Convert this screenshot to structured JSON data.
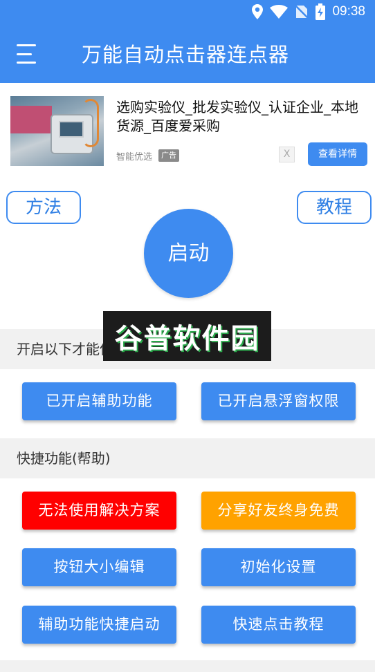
{
  "status_bar": {
    "time": "09:38",
    "icons": [
      "location-icon",
      "wifi-icon",
      "no-sim-icon",
      "battery-charging-icon"
    ]
  },
  "app_bar": {
    "menu_icon": "hamburger-menu-icon",
    "title": "万能自动点击器连点器"
  },
  "ad": {
    "title": "选购实验仪_批发实验仪_认证企业_本地货源_百度爱采购",
    "source": "智能优选",
    "tag": "广告",
    "close": "X",
    "detail_button": "查看详情"
  },
  "controls": {
    "method": "方法",
    "tutorial": "教程",
    "start": "启动"
  },
  "watermark": "谷普软件园",
  "section_permissions": {
    "header": "开启以下才能使用",
    "accessibility_button": "已开启辅助功能",
    "overlay_button": "已开启悬浮窗权限"
  },
  "section_shortcuts": {
    "header": "快捷功能(帮助)",
    "unusable_button": "无法使用解决方案",
    "share_button": "分享好友终身免费",
    "button_size_button": "按钮大小编辑",
    "init_button": "初始化设置",
    "accessibility_shortcut_button": "辅助功能快捷启动",
    "quick_tutorial_button": "快速点击教程"
  },
  "colors": {
    "primary": "#3e8bf0",
    "danger": "#ff0000",
    "warning": "#ffa200",
    "section_bg": "#f1f1f1"
  }
}
